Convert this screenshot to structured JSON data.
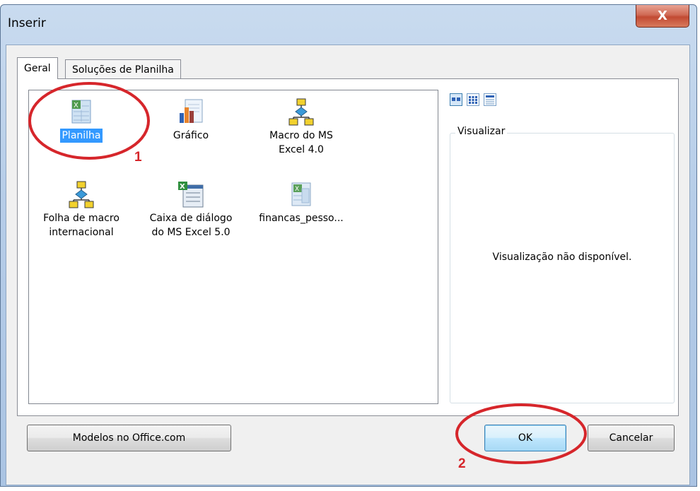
{
  "window": {
    "title": "Inserir",
    "close_glyph": "X"
  },
  "tabs": [
    {
      "label": "Geral",
      "active": true
    },
    {
      "label": "Soluções de Planilha",
      "active": false
    }
  ],
  "items": [
    {
      "label": "Planilha",
      "icon": "worksheet-icon",
      "selected": true
    },
    {
      "label": "Gráfico",
      "icon": "chart-icon",
      "selected": false
    },
    {
      "label": "Macro do MS Excel 4.0",
      "icon": "macro-icon",
      "selected": false
    },
    {
      "label": "Folha de macro internacional",
      "icon": "macro-icon",
      "selected": false
    },
    {
      "label": "Caixa de diálogo do MS Excel 5.0",
      "icon": "dialog-sheet-icon",
      "selected": false
    },
    {
      "label": "financas_pesso...",
      "icon": "template-icon",
      "selected": false
    }
  ],
  "view_buttons": [
    {
      "icon": "large-icons-view-icon",
      "active": true
    },
    {
      "icon": "list-view-icon",
      "active": false
    },
    {
      "icon": "details-view-icon",
      "active": false
    }
  ],
  "preview": {
    "legend": "Visualizar",
    "message": "Visualização não disponível."
  },
  "buttons": {
    "templates": "Modelos no Office.com",
    "ok": "OK",
    "cancel": "Cancelar"
  },
  "annotations": {
    "step1": "1",
    "step2": "2",
    "color": "#d6262b"
  }
}
